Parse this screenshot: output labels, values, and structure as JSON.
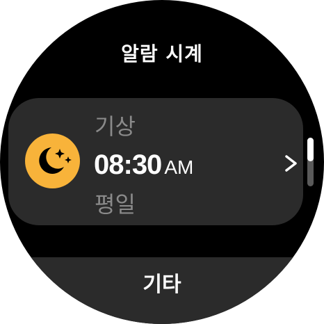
{
  "header": {
    "title": "알람 시계"
  },
  "alarm": {
    "label": "기상",
    "time": "08:30",
    "ampm": "AM",
    "repeat": "평일",
    "icon": "moon-stars-icon",
    "icon_color": "#f8b33a"
  },
  "footer": {
    "more_label": "기타"
  },
  "colors": {
    "background": "#000000",
    "card": "#2b2b2b",
    "secondary_text": "#8a8a8a",
    "accent": "#f8b33a"
  }
}
